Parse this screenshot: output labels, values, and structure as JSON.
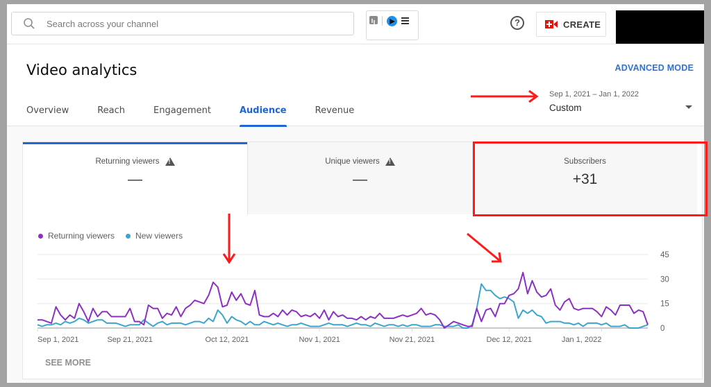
{
  "topbar": {
    "search_placeholder": "Search across your channel",
    "icons": [
      "search-icon",
      "extension-stats-icon",
      "extension-play-icon",
      "extension-menu-icon",
      "help-icon",
      "create-video-icon"
    ],
    "create_label": "CREATE"
  },
  "header": {
    "title": "Video analytics",
    "advanced_mode_label": "ADVANCED MODE",
    "date_range": "Sep 1, 2021 – Jan 1, 2022",
    "date_preset": "Custom",
    "tabs": [
      {
        "label": "Overview",
        "active": false
      },
      {
        "label": "Reach",
        "active": false
      },
      {
        "label": "Engagement",
        "active": false
      },
      {
        "label": "Audience",
        "active": true
      },
      {
        "label": "Revenue",
        "active": false
      }
    ]
  },
  "metrics": [
    {
      "label": "Returning viewers",
      "value": "—",
      "warning": true,
      "selected": true
    },
    {
      "label": "Unique viewers",
      "value": "—",
      "warning": true,
      "selected": false
    },
    {
      "label": "Subscribers",
      "value": "+31",
      "warning": false,
      "selected": false,
      "annotated": true
    }
  ],
  "colors": {
    "accent": "#1f65d6",
    "returning": "#8e2fc4",
    "new": "#3aa6cf",
    "annotation": "#ff1a1a",
    "create_icon": "#e1140f"
  },
  "see_more_label": "SEE MORE",
  "chart_data": {
    "type": "line",
    "title": "",
    "xlabel": "",
    "ylabel": "",
    "x_start": "2021-09-01",
    "x_end": "2022-01-01",
    "x_tick_labels": [
      "Sep 1, 2021",
      "Sep 21, 2021",
      "Oct 12, 2021",
      "Nov 1, 2021",
      "Nov 21, 2021",
      "Dec 12, 2021",
      "Jan 1, 2022"
    ],
    "x_tick_day_index": [
      0,
      20,
      41,
      61,
      81,
      102,
      122
    ],
    "y_ticks": [
      0,
      15,
      30,
      45
    ],
    "ylim": [
      0,
      45
    ],
    "y_axis_side": "right",
    "grid": true,
    "legend_position": "top-left",
    "series": [
      {
        "name": "Returning viewers",
        "color": "#8e2fc4",
        "values": [
          5,
          5,
          4,
          3,
          13,
          8,
          5,
          8,
          6,
          15,
          10,
          4,
          12,
          7,
          10,
          10,
          7,
          7,
          7,
          7,
          12,
          4,
          4,
          2,
          14,
          12,
          12,
          6,
          9,
          8,
          13,
          7,
          12,
          14,
          17,
          16,
          15,
          20,
          28,
          25,
          13,
          14,
          22,
          17,
          21,
          15,
          14,
          23,
          8,
          7,
          7,
          9,
          7,
          11,
          8,
          11,
          10,
          7,
          8,
          7,
          9,
          6,
          11,
          5,
          10,
          7,
          8,
          6,
          6,
          5,
          7,
          5,
          7,
          6,
          9,
          6,
          6,
          6,
          7,
          8,
          7,
          8,
          9,
          12,
          8,
          9,
          8,
          5,
          0,
          2,
          4,
          3,
          2,
          1,
          1,
          12,
          4,
          11,
          12,
          7,
          15,
          15,
          20,
          21,
          24,
          34,
          21,
          29,
          22,
          19,
          20,
          24,
          14,
          11,
          16,
          18,
          12,
          11,
          12,
          12,
          12,
          10,
          7,
          13,
          11,
          8,
          14,
          14,
          14,
          9,
          11,
          10,
          2
        ]
      },
      {
        "name": "New viewers",
        "color": "#3aa6cf",
        "values": [
          2,
          1,
          2,
          2,
          3,
          2,
          4,
          3,
          4,
          6,
          5,
          3,
          4,
          5,
          5,
          3,
          3,
          3,
          2,
          1,
          2,
          2,
          2,
          5,
          3,
          1,
          3,
          4,
          2,
          3,
          3,
          3,
          2,
          3,
          4,
          4,
          3,
          6,
          4,
          11,
          8,
          3,
          7,
          5,
          4,
          2,
          4,
          2,
          2,
          4,
          3,
          2,
          3,
          2,
          1,
          2,
          2,
          3,
          2,
          1,
          1,
          1,
          2,
          3,
          2,
          2,
          2,
          1,
          2,
          3,
          2,
          2,
          1,
          3,
          2,
          1,
          2,
          2,
          1,
          2,
          1,
          2,
          2,
          1,
          1,
          1,
          2,
          2,
          1,
          1,
          1,
          2,
          0,
          0,
          2,
          12,
          27,
          23,
          23,
          20,
          18,
          19,
          18,
          16,
          6,
          11,
          9,
          11,
          8,
          7,
          3,
          4,
          4,
          4,
          3,
          3,
          2,
          3,
          1,
          3,
          3,
          3,
          2,
          3,
          1,
          1,
          1,
          2,
          0,
          0,
          0,
          1,
          2
        ]
      }
    ]
  }
}
